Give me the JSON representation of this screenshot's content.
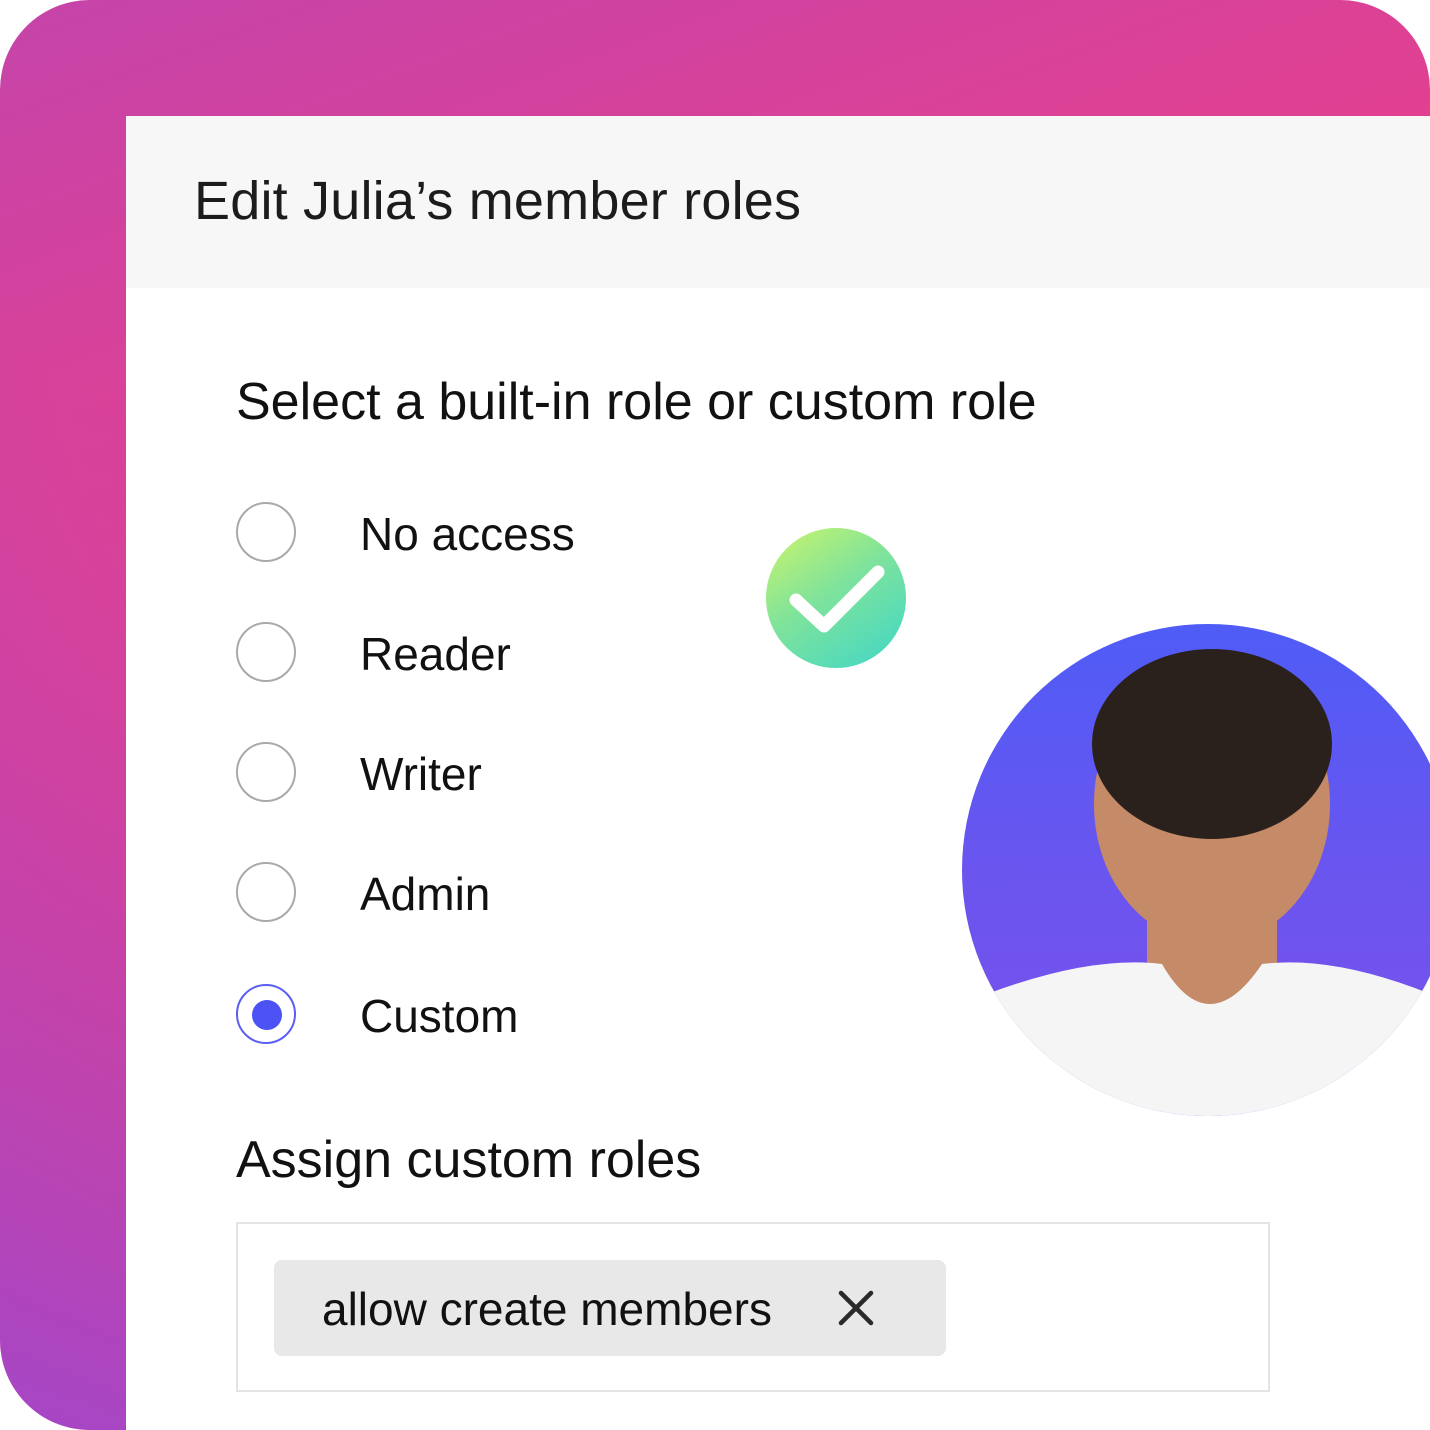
{
  "dialog": {
    "title": "Edit Julia’s member roles"
  },
  "role_section": {
    "heading": "Select a built-in role or custom role",
    "options": [
      {
        "label": "No access",
        "selected": false
      },
      {
        "label": "Reader",
        "selected": false
      },
      {
        "label": "Writer",
        "selected": false
      },
      {
        "label": "Admin",
        "selected": false
      },
      {
        "label": "Custom",
        "selected": true
      }
    ]
  },
  "custom_roles": {
    "heading": "Assign custom roles",
    "chips": [
      {
        "label": "allow create members",
        "remove_icon": "close-icon"
      }
    ]
  },
  "avatar": {
    "icon": "check-icon",
    "colors": {
      "circle": "#5a58f2",
      "badge_from": "#cdf56a",
      "badge_to": "#3ed6c8"
    }
  },
  "colors": {
    "accent": "#4d52f5",
    "frame_from": "#c544a9",
    "frame_to": "#f73b73"
  }
}
